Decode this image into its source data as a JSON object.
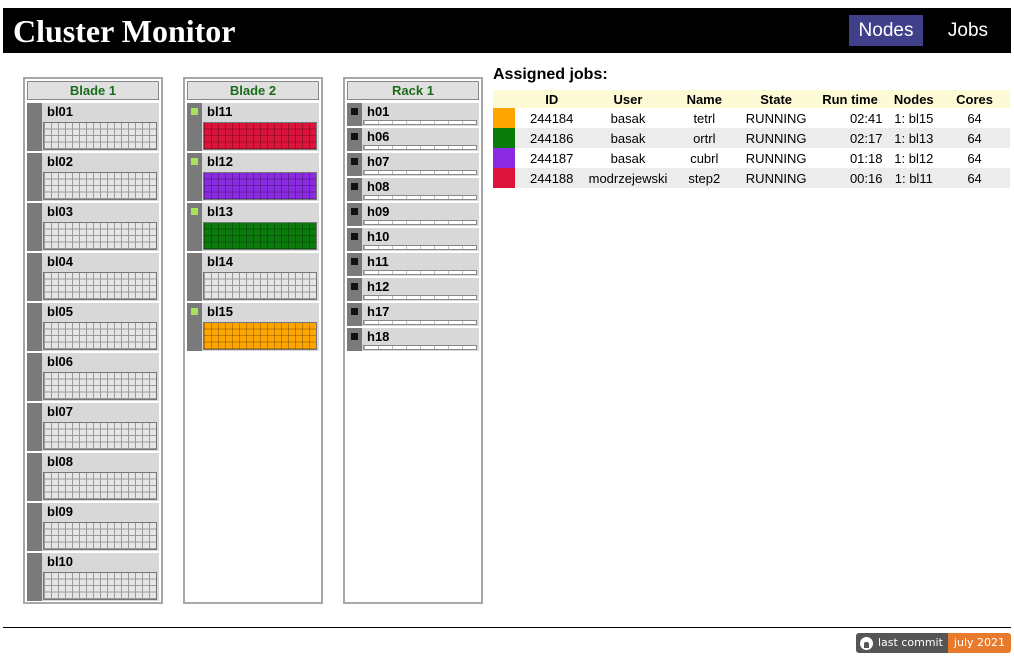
{
  "app": {
    "title": "Cluster Monitor"
  },
  "nav": {
    "nodes_label": "Nodes",
    "jobs_label": "Jobs",
    "active": "Nodes"
  },
  "colors": {
    "idle_led": "#111111",
    "busy_led": "#a6e35a",
    "empty_cell": "#e6e6e6",
    "header_bg": "#000000",
    "nav_active": "#3f3f8a"
  },
  "groups": [
    {
      "title": "Blade 1",
      "kind": "blade",
      "nodes": [
        {
          "name": "bl01",
          "job": null
        },
        {
          "name": "bl02",
          "job": null
        },
        {
          "name": "bl03",
          "job": null
        },
        {
          "name": "bl04",
          "job": null
        },
        {
          "name": "bl05",
          "job": null
        },
        {
          "name": "bl06",
          "job": null
        },
        {
          "name": "bl07",
          "job": null
        },
        {
          "name": "bl08",
          "job": null
        },
        {
          "name": "bl09",
          "job": null
        },
        {
          "name": "bl10",
          "job": null
        }
      ]
    },
    {
      "title": "Blade 2",
      "kind": "blade",
      "nodes": [
        {
          "name": "bl11",
          "job": "244188"
        },
        {
          "name": "bl12",
          "job": "244187"
        },
        {
          "name": "bl13",
          "job": "244186"
        },
        {
          "name": "bl14",
          "job": null
        },
        {
          "name": "bl15",
          "job": "244184"
        }
      ]
    },
    {
      "title": "Rack 1",
      "kind": "rack",
      "nodes": [
        {
          "name": "h01"
        },
        {
          "name": "h06"
        },
        {
          "name": "h07"
        },
        {
          "name": "h08"
        },
        {
          "name": "h09"
        },
        {
          "name": "h10"
        },
        {
          "name": "h11"
        },
        {
          "name": "h12"
        },
        {
          "name": "h17"
        },
        {
          "name": "h18"
        }
      ]
    }
  ],
  "jobs": {
    "title": "Assigned jobs:",
    "columns": [
      "ID",
      "User",
      "Name",
      "State",
      "Run time",
      "Nodes",
      "Cores"
    ],
    "rows": [
      {
        "color": "#ffa500",
        "id": "244184",
        "user": "basak",
        "name": "tetrl",
        "state": "RUNNING",
        "runtime": "02:41",
        "nodes": "1: bl15",
        "cores": "64"
      },
      {
        "color": "#0a7a0a",
        "id": "244186",
        "user": "basak",
        "name": "ortrl",
        "state": "RUNNING",
        "runtime": "02:17",
        "nodes": "1: bl13",
        "cores": "64"
      },
      {
        "color": "#8a2be2",
        "id": "244187",
        "user": "basak",
        "name": "cubrl",
        "state": "RUNNING",
        "runtime": "01:18",
        "nodes": "1: bl12",
        "cores": "64"
      },
      {
        "color": "#dc143c",
        "id": "244188",
        "user": "modrzejewski",
        "name": "step2",
        "state": "RUNNING",
        "runtime": "00:16",
        "nodes": "1: bl11",
        "cores": "64"
      }
    ]
  },
  "footer": {
    "badge_left": "last commit",
    "badge_right": "july 2021",
    "icon": "github-icon"
  }
}
